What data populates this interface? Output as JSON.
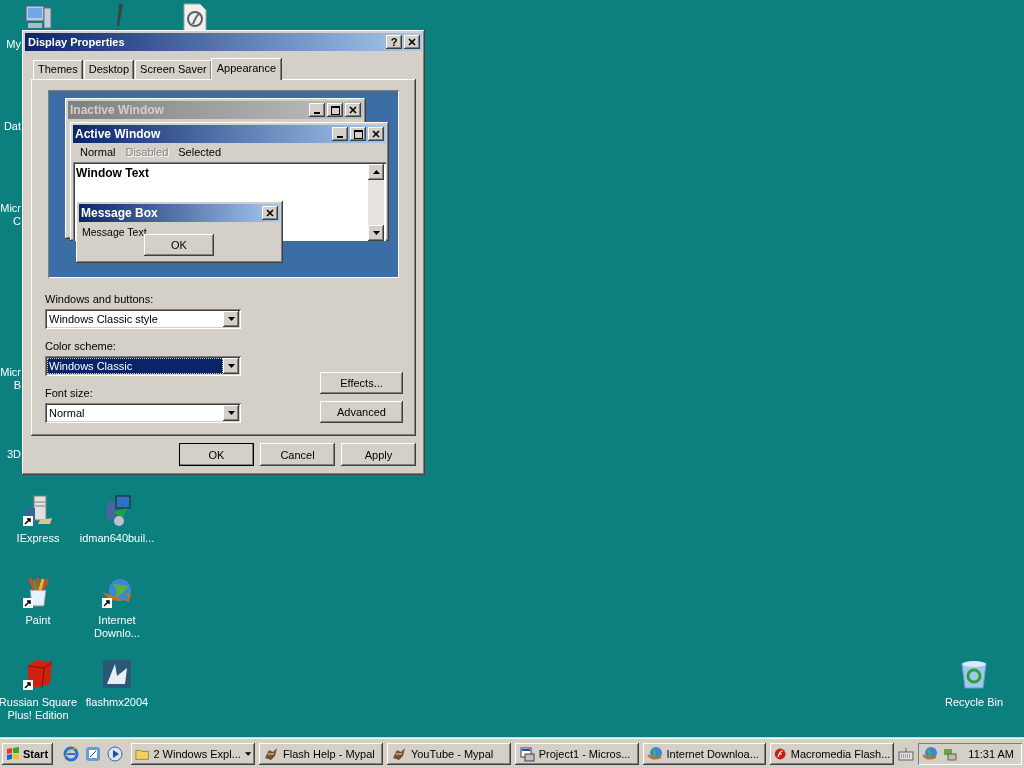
{
  "desktop": {
    "left_columns": [
      [
        {
          "kind": "peek",
          "label_lines": [
            "My"
          ]
        },
        {
          "kind": "behind",
          "label_lines": [
            "Dat"
          ]
        },
        {
          "kind": "behind",
          "label_lines": [
            "Micr",
            "C"
          ]
        },
        {
          "kind": "empty"
        },
        {
          "kind": "behind",
          "label_lines": [
            "Micr",
            "B"
          ]
        },
        {
          "kind": "behind",
          "label_lines": [
            "3D"
          ]
        },
        {
          "kind": "icon",
          "label_lines": [
            "IExpress"
          ]
        },
        {
          "kind": "icon",
          "label_lines": [
            "Paint"
          ]
        },
        {
          "kind": "icon",
          "label_lines": [
            "Russian Square",
            "Plus! Edition"
          ]
        }
      ],
      [
        {
          "kind": "peek"
        },
        {
          "kind": "empty"
        },
        {
          "kind": "empty"
        },
        {
          "kind": "empty"
        },
        {
          "kind": "empty"
        },
        {
          "kind": "empty"
        },
        {
          "kind": "icon",
          "label_lines": [
            "idman640buil..."
          ]
        },
        {
          "kind": "icon",
          "label_lines": [
            "Internet",
            "Downlo..."
          ]
        },
        {
          "kind": "icon",
          "label_lines": [
            "flashmx2004"
          ]
        }
      ],
      [
        {
          "kind": "peek"
        }
      ]
    ],
    "right_columns": [
      [
        {
          "kind": "empty"
        },
        {
          "kind": "empty"
        },
        {
          "kind": "empty"
        },
        {
          "kind": "empty"
        },
        {
          "kind": "empty"
        },
        {
          "kind": "empty"
        },
        {
          "kind": "empty"
        },
        {
          "kind": "empty"
        },
        {
          "kind": "icon",
          "label_lines": [
            "Recycle Bin"
          ]
        }
      ]
    ]
  },
  "dialog": {
    "title": "Display Properties",
    "help_button": "?",
    "tabs": [
      {
        "label": "Themes",
        "selected": false
      },
      {
        "label": "Desktop",
        "selected": false
      },
      {
        "label": "Screen Saver",
        "selected": false
      },
      {
        "label": "Appearance",
        "selected": true
      }
    ],
    "preview": {
      "inactive_title": "Inactive Window",
      "active_title": "Active Window",
      "menu": [
        {
          "label": "Normal",
          "disabled": false
        },
        {
          "label": "Disabled",
          "disabled": true
        },
        {
          "label": "Selected",
          "disabled": false
        }
      ],
      "window_text": "Window Text",
      "message_box": {
        "title": "Message Box",
        "text": "Message Text",
        "button": "OK"
      }
    },
    "fields": [
      {
        "label": "Windows and buttons:",
        "value": "Windows Classic style",
        "focused": false
      },
      {
        "label": "Color scheme:",
        "value": "Windows Classic",
        "focused": true
      },
      {
        "label": "Font size:",
        "value": "Normal",
        "focused": false
      }
    ],
    "side_buttons": [
      "Effects...",
      "Advanced"
    ],
    "footer_buttons": [
      {
        "label": "OK",
        "default": true
      },
      {
        "label": "Cancel",
        "default": false
      },
      {
        "label": "Apply",
        "default": false
      }
    ]
  },
  "taskbar": {
    "start_label": "Start",
    "tasks": [
      {
        "label": "2 Windows Expl...",
        "kind": "group"
      },
      {
        "label": "Flash Help - Mypal",
        "kind": "window"
      },
      {
        "label": "YouTube - Mypal",
        "kind": "window"
      },
      {
        "label": "Project1 - Micros...",
        "kind": "window"
      },
      {
        "label": "Internet Downloa...",
        "kind": "window"
      },
      {
        "label": "Macromedia Flash...",
        "kind": "window"
      }
    ],
    "clock": "11:31 AM"
  }
}
